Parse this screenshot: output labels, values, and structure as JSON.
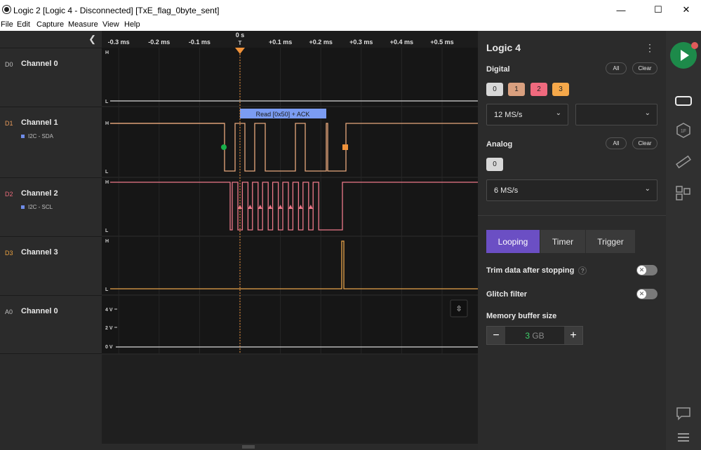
{
  "window": {
    "title": "Logic 2 [Logic 4 - Disconnected] [TxE_flag_0byte_sent]",
    "minimize": "—",
    "maximize": "☐",
    "close": "✕"
  },
  "menu": [
    "File",
    "Edit",
    "Capture",
    "Measure",
    "View",
    "Help"
  ],
  "channels": [
    {
      "id": "D0",
      "name": "Channel 0",
      "sub": "",
      "id_color": "#bfbfbf"
    },
    {
      "id": "D1",
      "name": "Channel 1",
      "sub": "I2C - SDA",
      "id_color": "#e89a5a"
    },
    {
      "id": "D2",
      "name": "Channel 2",
      "sub": "I2C - SCL",
      "id_color": "#e86a7a"
    },
    {
      "id": "D3",
      "name": "Channel 3",
      "sub": "",
      "id_color": "#e8a040"
    },
    {
      "id": "A0",
      "name": "Channel 0",
      "sub": "",
      "id_color": "#bfbfbf"
    }
  ],
  "timeline": {
    "cursor_label": "0 s",
    "trigger_mark": "T",
    "ticks": [
      "-0.3 ms",
      "-0.2 ms",
      "-0.1 ms",
      "+0.1 ms",
      "+0.2 ms",
      "+0.3 ms",
      "+0.4 ms",
      "+0.5 ms"
    ],
    "high": "H",
    "low": "L"
  },
  "decoder": {
    "label": "Read [0x50] + ACK",
    "color": "#7b9cf2"
  },
  "analog_axis": [
    "4 V",
    "2 V",
    "0 V"
  ],
  "colors": {
    "sda": "#e8a87c",
    "scl": "#ee7a8a",
    "ch3": "#e8a44a",
    "trigger": "#f0923a",
    "start_marker": "#19b04a",
    "stop_marker": "#f0923a",
    "accent": "#6b4fc4",
    "run": "#1d8a4a"
  },
  "panel": {
    "device": "Logic 4",
    "menu_icon": "⋮",
    "digital": {
      "label": "Digital",
      "all": "All",
      "clear": "Clear",
      "chips": [
        {
          "label": "0",
          "color": "#d8d8d8"
        },
        {
          "label": "1",
          "color": "#d9a07f"
        },
        {
          "label": "2",
          "color": "#f06a7e"
        },
        {
          "label": "3",
          "color": "#f5a84a"
        }
      ],
      "rate": "12 MS/s",
      "rate2": ""
    },
    "analog": {
      "label": "Analog",
      "all": "All",
      "clear": "Clear",
      "chip": "0",
      "rate": "6 MS/s"
    },
    "tabs": [
      "Looping",
      "Timer",
      "Trigger"
    ],
    "active_tab": "Looping",
    "trim_label": "Trim data after stopping",
    "trim_enabled": false,
    "glitch_label": "Glitch filter",
    "glitch_enabled": false,
    "memory_label": "Memory buffer size",
    "memory_value": "3",
    "memory_unit": "GB",
    "minus": "−",
    "plus": "+"
  },
  "toolbar": [
    "device-icon",
    "analyzers-icon",
    "measure-icon",
    "extensions-icon",
    "chat-icon",
    "menu-icon"
  ]
}
